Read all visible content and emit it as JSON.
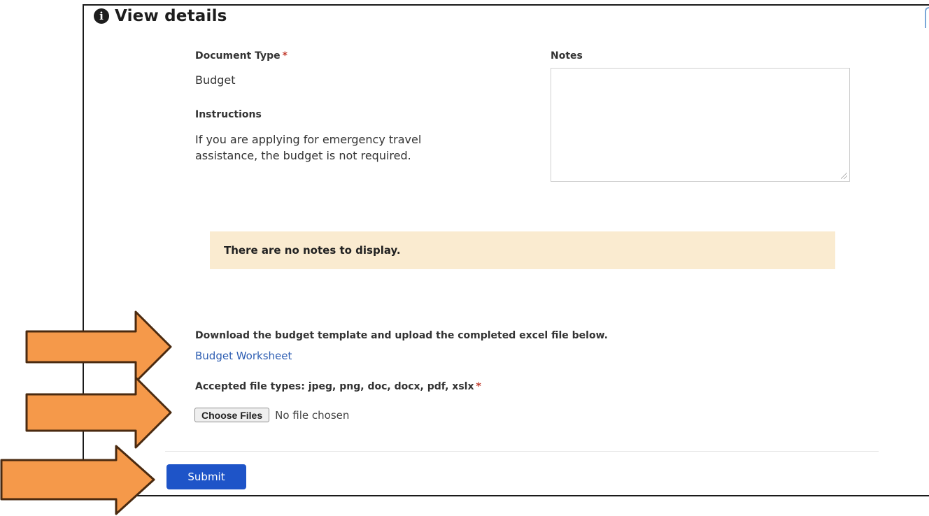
{
  "header": {
    "title": "View details",
    "icon": "info-icon"
  },
  "document_type": {
    "label": "Document Type",
    "required_mark": "*",
    "value": "Budget"
  },
  "instructions": {
    "label": "Instructions",
    "line1": "If you are applying for emergency travel",
    "line2": "assistance, the budget is not required."
  },
  "notes": {
    "label": "Notes",
    "value": ""
  },
  "alert": {
    "text": "There are no notes to display.",
    "background": "#faebd0"
  },
  "download": {
    "text": "Download the budget template and upload the completed excel file below.",
    "link_label": "Budget Worksheet"
  },
  "upload": {
    "label": "Accepted file types: jpeg, png, doc, docx, pdf, xslx",
    "required_mark": "*",
    "button_label": "Choose Files",
    "status": "No file chosen"
  },
  "submit": {
    "label": "Submit",
    "color": "#1e54c8"
  },
  "annotation_arrows": {
    "count": 3,
    "color": "#f5994a",
    "outline": "#4a2a10"
  }
}
